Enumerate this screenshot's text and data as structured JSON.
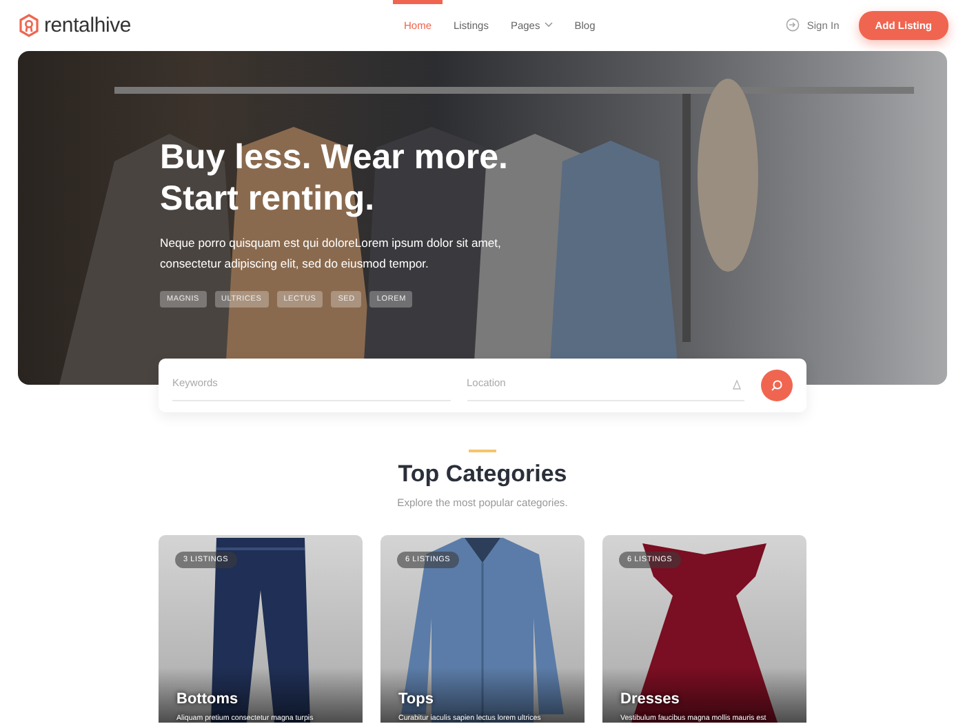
{
  "header": {
    "logo": "rentalhive",
    "nav": [
      {
        "label": "Home",
        "selected": true,
        "has_menu": false
      },
      {
        "label": "Listings",
        "selected": false,
        "has_menu": false
      },
      {
        "label": "Pages",
        "selected": false,
        "has_menu": true
      },
      {
        "label": "Blog",
        "selected": false,
        "has_menu": false
      }
    ],
    "sign_in": "Sign In",
    "add_listing": "Add Listing"
  },
  "hero": {
    "title": "Buy less. Wear more. Start renting.",
    "subtitle": "Neque porro quisquam est qui doloreLorem ipsum dolor sit amet, consectetur adipiscing elit, sed do eiusmod tempor.",
    "tags": [
      "MAGNIS",
      "ULTRICES",
      "LECTUS",
      "SED",
      "LOREM"
    ]
  },
  "search": {
    "keywords_placeholder": "Keywords",
    "location_placeholder": "Location"
  },
  "categories": {
    "title": "Top Categories",
    "subtitle": "Explore the most popular categories.",
    "items": [
      {
        "kind": "jeans",
        "count": "3 LISTINGS",
        "name": "Bottoms",
        "description": "Aliquam pretium consectetur magna turpis"
      },
      {
        "kind": "shirt",
        "count": "6 LISTINGS",
        "name": "Tops",
        "description": "Curabitur iaculis sapien lectus lorem ultrices"
      },
      {
        "kind": "dress",
        "count": "6 LISTINGS",
        "name": "Dresses",
        "description": "Vestibulum faucibus magna mollis mauris est"
      }
    ]
  }
}
